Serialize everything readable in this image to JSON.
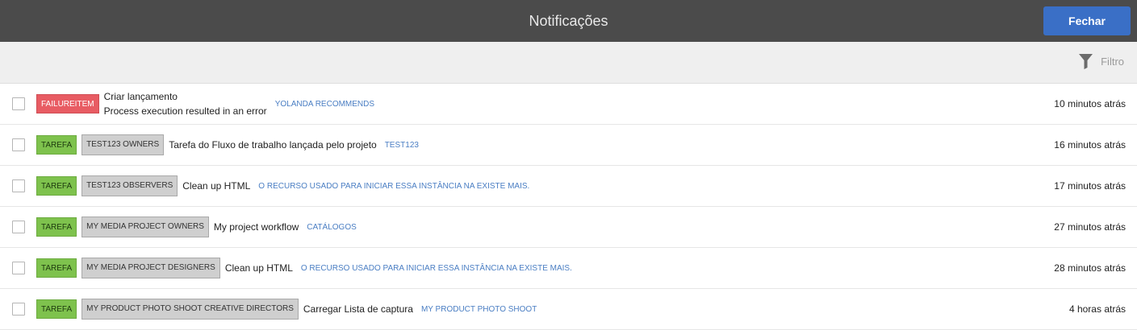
{
  "header": {
    "title": "Notificações",
    "close_label": "Fechar"
  },
  "toolbar": {
    "filter_label": "Filtro"
  },
  "notifications": [
    {
      "type": "FAILUREITEM",
      "title": "Criar lançamento",
      "message": "Process execution resulted in an error",
      "link": "YOLANDA RECOMMENDS",
      "time": "10 minutos atrás"
    },
    {
      "type": "TAREFA",
      "assignee": "TEST123 OWNERS",
      "message": "Tarefa do Fluxo de trabalho lançada pelo projeto",
      "link": "TEST123",
      "time": "16 minutos atrás"
    },
    {
      "type": "TAREFA",
      "assignee": "TEST123 OBSERVERS",
      "message": "Clean up HTML",
      "link": "O RECURSO USADO PARA INICIAR ESSA INSTÂNCIA NA EXISTE MAIS.",
      "time": "17 minutos atrás"
    },
    {
      "type": "TAREFA",
      "assignee": "MY MEDIA PROJECT OWNERS",
      "message": "My project workflow",
      "link": "CATÁLOGOS",
      "time": "27 minutos atrás"
    },
    {
      "type": "TAREFA",
      "assignee": "MY MEDIA PROJECT DESIGNERS",
      "message": "Clean up HTML",
      "link": "O RECURSO USADO PARA INICIAR ESSA INSTÂNCIA NA EXISTE MAIS.",
      "time": "28 minutos atrás"
    },
    {
      "type": "TAREFA",
      "assignee": "MY PRODUCT PHOTO SHOOT CREATIVE DIRECTORS",
      "message": "Carregar Lista de captura",
      "link": "MY PRODUCT PHOTO SHOOT",
      "time": "4 horas atrás"
    }
  ],
  "colors": {
    "header_bg": "#4b4b4b",
    "accent": "#3a6fc6",
    "failure": "#e85c63",
    "task": "#7ec24d",
    "link": "#4a7ec3"
  }
}
